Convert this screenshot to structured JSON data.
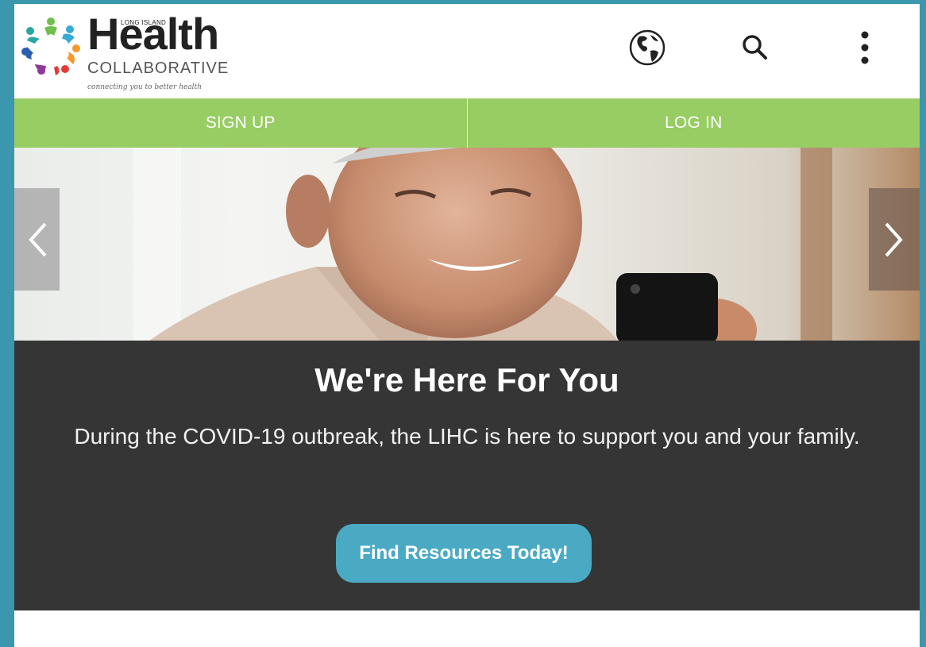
{
  "brand": {
    "small_label": "LONG ISLAND",
    "name": "Health",
    "sub": "COLLABORATIVE",
    "tagline": "connecting you to better health"
  },
  "header_icons": [
    "globe-icon",
    "search-icon",
    "more-vertical-icon"
  ],
  "auth": {
    "signup_label": "SIGN UP",
    "login_label": "LOG IN"
  },
  "hero": {
    "prev_icon": "chevron-left-icon",
    "next_icon": "chevron-right-icon"
  },
  "banner": {
    "title": "We're Here For You",
    "text": "During the COVID-19 outbreak, the LIHC is here to support you and your family.",
    "cta_label": "Find Resources Today!"
  },
  "colors": {
    "page_border": "#3a97ad",
    "auth_bar": "#97cd63",
    "banner_bg": "#353535",
    "cta": "#4aaac4"
  }
}
